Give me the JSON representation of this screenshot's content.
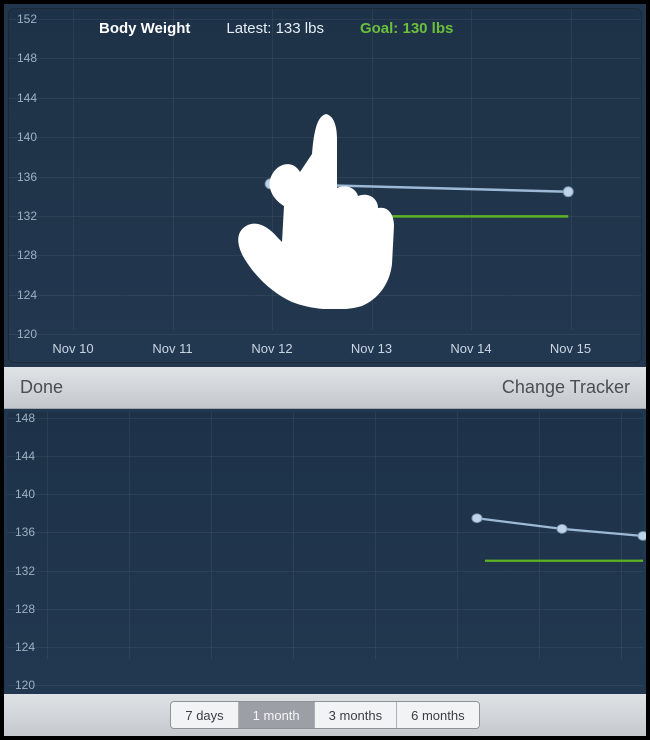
{
  "top": {
    "title": "Body Weight",
    "latest": "Latest: 133 lbs",
    "goal": "Goal: 130 lbs",
    "yTicks": [
      "152",
      "148",
      "144",
      "140",
      "136",
      "132",
      "128",
      "124",
      "120"
    ],
    "xTicks": [
      "Nov 10",
      "Nov 11",
      "Nov 12",
      "Nov 13",
      "Nov 14",
      "Nov 15",
      "Nov"
    ]
  },
  "toolbar": {
    "done": "Done",
    "change": "Change Tracker"
  },
  "bot": {
    "yTicks": [
      "148",
      "144",
      "140",
      "136",
      "132",
      "128",
      "124",
      "120"
    ]
  },
  "segments": [
    "7 days",
    "1 month",
    "3 months",
    "6 months"
  ],
  "segmentSelected": 1,
  "chart_data": [
    {
      "type": "line",
      "title": "Body Weight",
      "ylabel": "lbs",
      "ylim": [
        120,
        152
      ],
      "xlabel": "",
      "categories": [
        "Nov 10",
        "Nov 11",
        "Nov 12",
        "Nov 13",
        "Nov 14",
        "Nov 15"
      ],
      "series": [
        {
          "name": "Body Weight",
          "x": [
            "Nov 12",
            "Nov 15"
          ],
          "values": [
            134,
            133
          ]
        },
        {
          "name": "Goal",
          "x": [
            "Nov 13",
            "Nov 15"
          ],
          "values": [
            130,
            130
          ]
        }
      ],
      "latest_label": "Latest: 133 lbs",
      "goal_label": "Goal: 130 lbs"
    },
    {
      "type": "line",
      "title": "",
      "ylabel": "",
      "ylim": [
        120,
        148
      ],
      "categories": [],
      "series": [
        {
          "name": "Body Weight",
          "values": [
            135,
            134,
            133
          ]
        },
        {
          "name": "Goal",
          "values": [
            130,
            130
          ]
        }
      ],
      "range_options": [
        "7 days",
        "1 month",
        "3 months",
        "6 months"
      ],
      "range_selected": "1 month"
    }
  ]
}
